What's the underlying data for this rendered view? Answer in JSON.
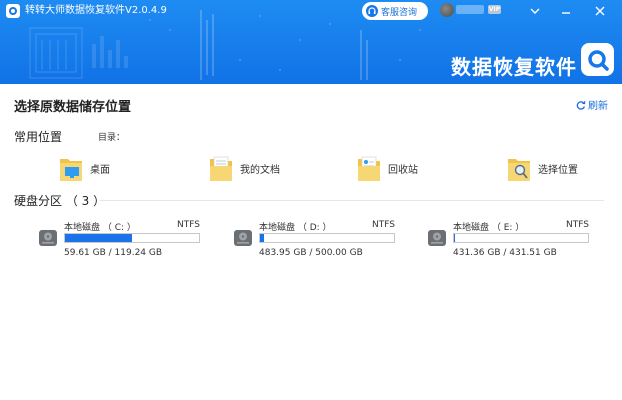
{
  "app": {
    "title": "转转大师数据恢复软件V2.0.4.9"
  },
  "header": {
    "customer_service": "客服咨询",
    "vip_badge": "VIP",
    "brand_text": "数据恢复软件",
    "menu_icon": "menu-icon",
    "minimize_icon": "minimize-icon",
    "close_icon": "close-icon"
  },
  "main": {
    "title": "选择原数据储存位置",
    "refresh": "刷新",
    "common_locations": {
      "title": "常用位置",
      "dir_label": "目录：",
      "items": [
        {
          "label": "桌面",
          "icon": "desktop-folder-icon"
        },
        {
          "label": "我的文档",
          "icon": "documents-folder-icon"
        },
        {
          "label": "回收站",
          "icon": "recycle-bin-icon"
        },
        {
          "label": "选择位置",
          "icon": "choose-location-icon"
        }
      ]
    },
    "partitions": {
      "title": "硬盘分区 （ 3 ）",
      "drives": [
        {
          "name": "本地磁盘 （ C: ）",
          "fs": "NTFS",
          "size": "59.61 GB / 119.24 GB",
          "used_fraction": 0.5
        },
        {
          "name": "本地磁盘 （ D: ）",
          "fs": "NTFS",
          "size": "483.95 GB / 500.00 GB",
          "used_fraction": 0.032
        },
        {
          "name": "本地磁盘 （ E: ）",
          "fs": "NTFS",
          "size": "431.36 GB / 431.51 GB",
          "used_fraction": 0.0035
        }
      ]
    }
  },
  "colors": {
    "header_blue": "#1577ea",
    "accent": "#1a73e8"
  }
}
